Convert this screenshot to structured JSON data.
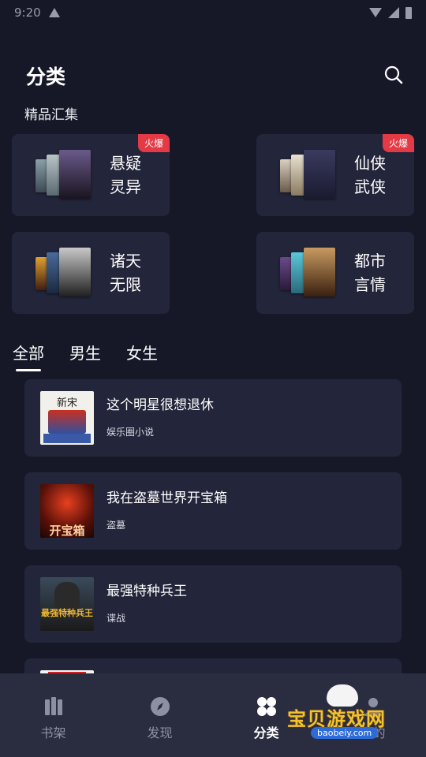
{
  "status_bar": {
    "time": "9:20"
  },
  "header": {
    "title": "分类"
  },
  "section": {
    "title": "精品汇集"
  },
  "categories": [
    {
      "line1": "悬疑",
      "line2": "灵异",
      "badge": "火爆"
    },
    {
      "line1": "仙侠",
      "line2": "武侠",
      "badge": "火爆"
    },
    {
      "line1": "诸天",
      "line2": "无限",
      "badge": ""
    },
    {
      "line1": "都市",
      "line2": "言情",
      "badge": ""
    }
  ],
  "tabs": [
    {
      "label": "全部",
      "active": true
    },
    {
      "label": "男生",
      "active": false
    },
    {
      "label": "女生",
      "active": false
    }
  ],
  "books": [
    {
      "title": "这个明星很想退休",
      "tag": "娱乐圈小说",
      "cover_text": "新宋"
    },
    {
      "title": "我在盗墓世界开宝箱",
      "tag": "盗墓",
      "cover_text": "开宝箱"
    },
    {
      "title": "最强特种兵王",
      "tag": "谍战",
      "cover_text": "最强特种兵王"
    }
  ],
  "bottom_nav": [
    {
      "label": "书架",
      "icon": "bookshelf-icon",
      "active": false
    },
    {
      "label": "发现",
      "icon": "compass-icon",
      "active": false
    },
    {
      "label": "分类",
      "icon": "category-icon",
      "active": true
    },
    {
      "label": "我的",
      "icon": "profile-icon",
      "active": false
    }
  ],
  "watermark": {
    "text": "宝贝游戏网",
    "url": "baobeiy.com"
  },
  "colors": {
    "background": "#161828",
    "card": "#23253a",
    "badge": "#e43a45",
    "nav_bg": "#2a2c40"
  }
}
